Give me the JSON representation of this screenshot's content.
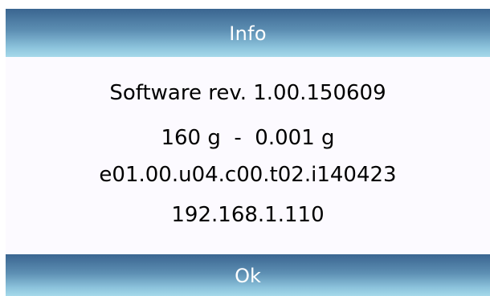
{
  "dialog": {
    "title": "Info",
    "lines": [
      "Software rev. 1.00.150609",
      "160 g  -  0.001 g",
      "e01.00.u04.c00.t02.i140423",
      "192.168.1.110"
    ],
    "ok_label": "Ok"
  },
  "colors": {
    "bar_top": "#3a6590",
    "bar_bottom": "#a6d9ea",
    "content_bg": "#fcfaff",
    "text": "#000000",
    "bar_text": "#ffffff"
  }
}
